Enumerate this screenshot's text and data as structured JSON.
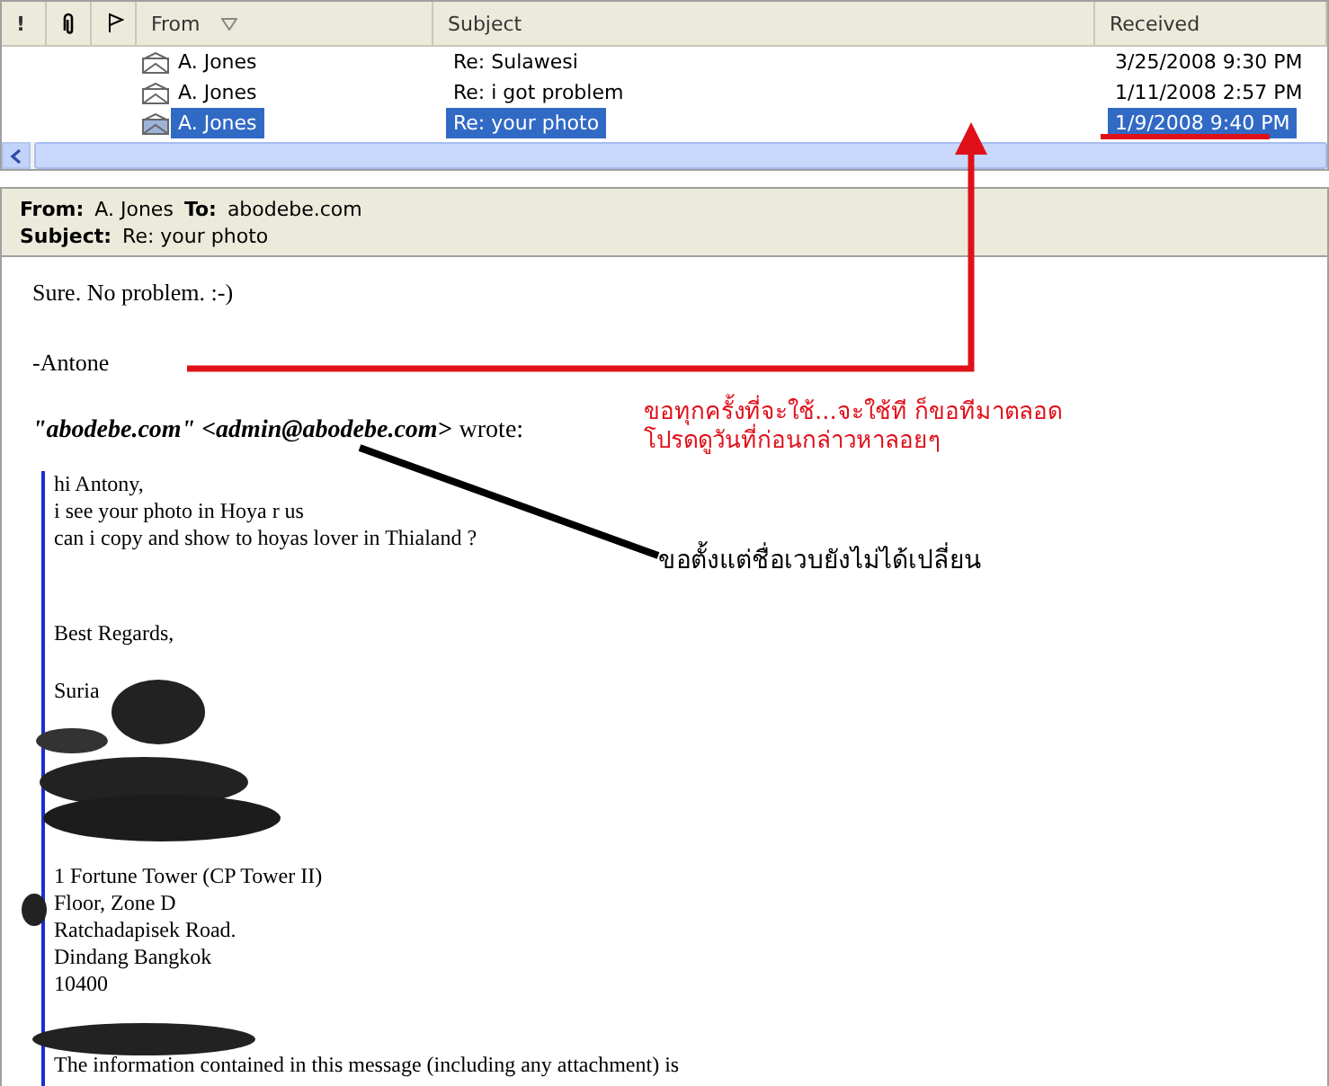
{
  "message_list": {
    "columns": [
      {
        "kind": "importance",
        "label": "!"
      },
      {
        "kind": "attachment"
      },
      {
        "kind": "flag"
      },
      {
        "kind": "text",
        "label": "From",
        "sorted": true
      },
      {
        "kind": "text",
        "label": "Subject"
      },
      {
        "kind": "text",
        "label": "Received"
      }
    ],
    "rows": [
      {
        "from": "A. Jones",
        "subject": "Re: Sulawesi",
        "received": "3/25/2008 9:30 PM",
        "selected": false
      },
      {
        "from": "A. Jones",
        "subject": "Re: i got problem",
        "received": "1/11/2008 2:57 PM",
        "selected": false
      },
      {
        "from": "A. Jones",
        "subject": "Re: your photo",
        "received": "1/9/2008 9:40 PM",
        "selected": true
      }
    ]
  },
  "preview_header": {
    "from_label": "From:",
    "from": "A. Jones",
    "to_label": "To:",
    "to": "abodebe.com",
    "subject_label": "Subject:",
    "subject": "Re: your photo"
  },
  "body": {
    "lines": [
      "Sure.  No problem.  :-)",
      "-Antone"
    ],
    "quote_header": {
      "sender": "\"abodebe.com\" <admin@abodebe.com>",
      "suffix": "wrote:"
    },
    "quote": [
      [
        "hi Antony,",
        "i see your photo in Hoya r us",
        "can i copy and show to hoyas lover in Thialand ?"
      ],
      [
        "Best Regards,"
      ],
      [
        "Suria"
      ],
      [
        "1 Fortune Tower (CP Tower II)",
        "Floor, Zone D",
        "Ratchadapisek Road.",
        "Dindang Bangkok",
        "10400"
      ],
      [
        "The information contained in this message (including any attachment)  is"
      ]
    ]
  },
  "annotations": [
    {
      "text": "ขอทุกครั้งที่จะใช้...จะใช้ที ก็ขอทีมาตลอด\nโปรดดูวันที่ก่อนกล่าวหาลอยๆ",
      "color": "#e0101a"
    },
    {
      "text": "ขอตั้งแต่ชื่อเวบยังไม่ได้เปลี่ยน",
      "color": "#000000"
    }
  ]
}
